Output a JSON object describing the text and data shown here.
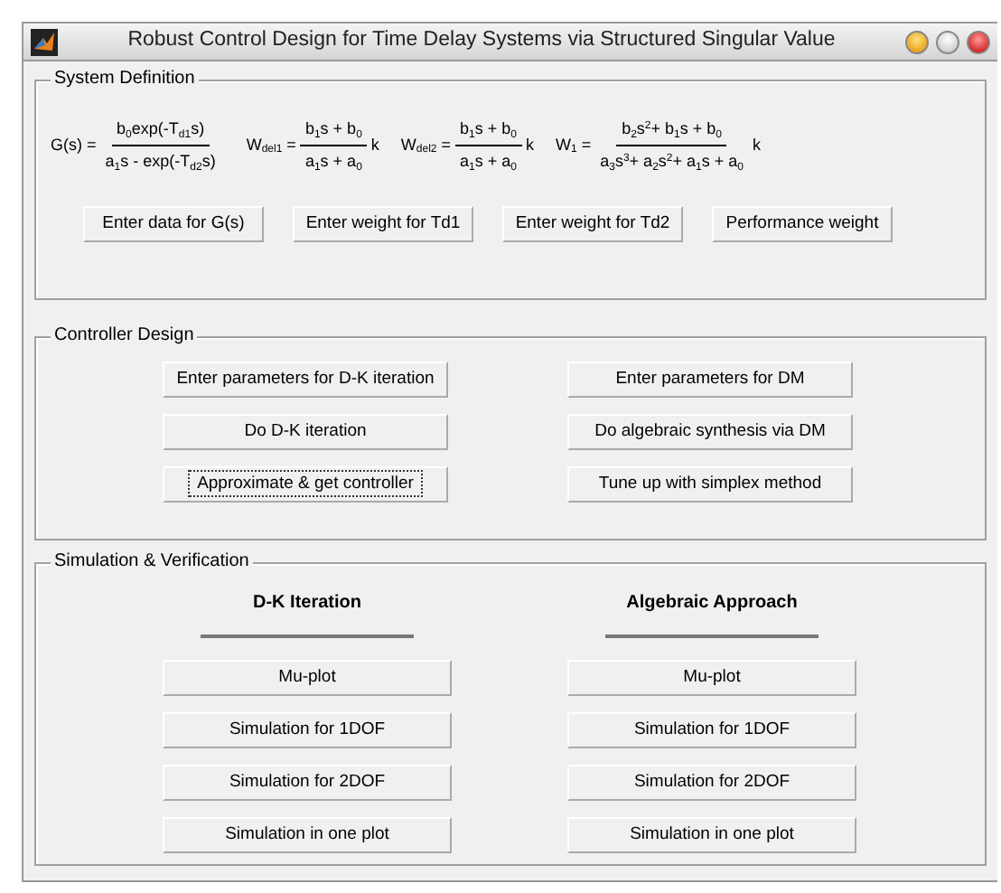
{
  "window": {
    "title": "Robust Control Design for Time Delay Systems via Structured Singular Value"
  },
  "system_definition": {
    "title": "System Definition",
    "formulas": [
      {
        "lhs": "G(s) =",
        "numerator": "b$_{0}$exp(-T$_{d1}$s)",
        "denominator": "a$_{1}$s - exp(-T$_{d2}$s)"
      },
      {
        "lhs": "W$_{del1}$ =",
        "numerator": "b$_{1}$s + b$_{0}$",
        "denominator": "a$_{1}$s + a$_{0}$",
        "suffix": "k"
      },
      {
        "lhs": "W$_{del2}$ =",
        "numerator": "b$_{1}$s + b$_{0}$",
        "denominator": "a$_{1}$s + a$_{0}$",
        "suffix": "k"
      },
      {
        "lhs": "W$_{1}$ =",
        "numerator": "b$_{2}$s$^{2}$+ b$_{1}$s + b$_{0}$",
        "denominator": "a$_{3}$s$^{3}$+ a$_{2}$s$^{2}$+ a$_{1}$s + a$_{0}$",
        "suffix": "k"
      }
    ],
    "buttons": [
      "Enter data for G(s)",
      "Enter weight for Td1",
      "Enter weight for Td2",
      "Performance weight"
    ]
  },
  "controller_design": {
    "title": "Controller Design",
    "buttons": [
      {
        "label": "Enter parameters for D-K iteration",
        "focused": false
      },
      {
        "label": "Enter parameters for DM",
        "focused": false
      },
      {
        "label": "Do D-K iteration",
        "focused": false
      },
      {
        "label": "Do algebraic synthesis via DM",
        "focused": false
      },
      {
        "label": "Approximate & get controller",
        "focused": true
      },
      {
        "label": "Tune up with simplex method",
        "focused": false
      }
    ]
  },
  "simulation": {
    "title": "Simulation & Verification",
    "columns": [
      {
        "heading": "D-K Iteration",
        "buttons": [
          "Mu-plot",
          "Simulation for 1DOF",
          "Simulation for 2DOF",
          "Simulation in one plot"
        ]
      },
      {
        "heading": "Algebraic Approach",
        "buttons": [
          "Mu-plot",
          "Simulation for 1DOF",
          "Simulation for 2DOF",
          "Simulation in one plot"
        ]
      }
    ]
  }
}
